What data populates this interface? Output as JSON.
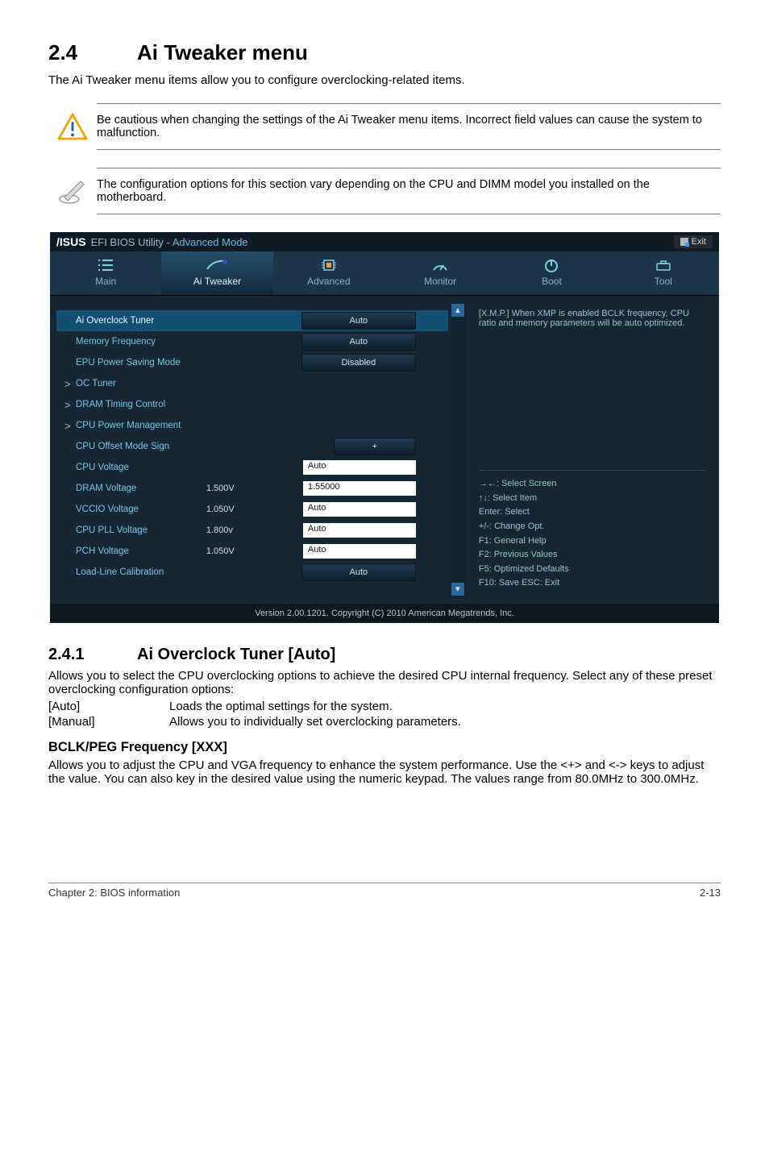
{
  "section": {
    "num": "2.4",
    "title": "Ai Tweaker menu"
  },
  "intro": "The Ai Tweaker menu items allow you to configure overclocking-related items.",
  "note_warn": "Be cautious when changing the settings of the Ai Tweaker menu items. Incorrect field values can cause the system to malfunction.",
  "note_info": "The configuration options for this section vary depending on the CPU and DIMM model you installed on the motherboard.",
  "bios": {
    "title_prefix": "EFI BIOS Utility - ",
    "title_mode": "Advanced Mode",
    "exit": "Exit",
    "tabs": {
      "main": "Main",
      "tweaker": "Ai   Tweaker",
      "advanced": "Advanced",
      "monitor": "Monitor",
      "boot": "Boot",
      "tool": "Tool"
    },
    "rows": {
      "overclock": {
        "label": "Ai Overclock Tuner",
        "val": "Auto"
      },
      "memfreq": {
        "label": "Memory Frequency",
        "val": "Auto"
      },
      "epu": {
        "label": "EPU Power Saving Mode",
        "val": "Disabled"
      },
      "octuner": {
        "label": "OC Tuner"
      },
      "dramtc": {
        "label": "DRAM Timing Control"
      },
      "cpupm": {
        "label": "CPU Power Management"
      },
      "offsign": {
        "label": "CPU Offset Mode Sign",
        "val": "+"
      },
      "cpuv": {
        "label": "CPU Voltage",
        "val": "Auto"
      },
      "dramv": {
        "label": "DRAM Voltage",
        "static": "1.500V",
        "val": "1.55000"
      },
      "vccio": {
        "label": "VCCIO Voltage",
        "static": "1.050V",
        "val": "Auto"
      },
      "pll": {
        "label": "CPU PLL Voltage",
        "static": "1.800v",
        "val": "Auto"
      },
      "pch": {
        "label": "PCH Voltage",
        "static": "1.050V",
        "val": "Auto"
      },
      "llc": {
        "label": "Load-Line Calibration",
        "val": "Auto"
      }
    },
    "help_top": "[X.M.P.] When XMP is enabled BCLK frequency, CPU ratio and memory parameters will be auto optimized.",
    "help_bottom": {
      "l1": "→←: Select Screen",
      "l2": "↑↓: Select Item",
      "l3": "Enter: Select",
      "l4": "+/-: Change Opt.",
      "l5": "F1: General Help",
      "l6": "F2: Previous Values",
      "l7": "F5: Optimized Defaults",
      "l8": "F10: Save   ESC: Exit"
    },
    "footer": "Version  2.00.1201.   Copyright  (C)  2010 American  Megatrends,  Inc."
  },
  "sub": {
    "num": "2.4.1",
    "title": "Ai Overclock Tuner [Auto]",
    "p1": "Allows you to select the CPU overclocking options to achieve the desired CPU internal frequency. Select any of these preset overclocking configuration options:",
    "opt_auto_k": "[Auto]",
    "opt_auto_v": "Loads the optimal settings for the system.",
    "opt_man_k": "[Manual]",
    "opt_man_v": "Allows you to individually set overclocking parameters."
  },
  "sub2": {
    "title": "BCLK/PEG Frequency [XXX]",
    "p": "Allows you to adjust the CPU and VGA frequency to enhance the system performance. Use the <+> and <-> keys to adjust the value. You can also key in the desired value using the numeric keypad. The values range from 80.0MHz to 300.0MHz."
  },
  "footer": {
    "left": "Chapter 2: BIOS information",
    "right": "2-13"
  }
}
